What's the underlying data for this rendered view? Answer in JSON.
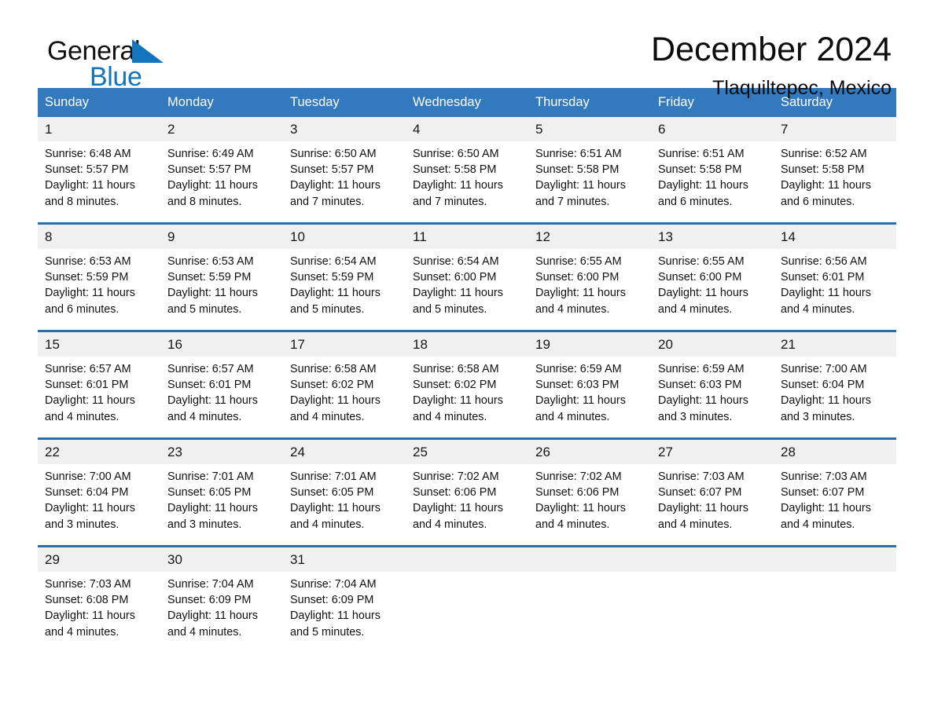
{
  "brand": {
    "word_one": "General",
    "word_two": "Blue",
    "triangle_icon": "brand-triangle-icon",
    "blue": "#1274bd"
  },
  "header": {
    "month_title": "December 2024",
    "location": "Tlaquiltepec, Mexico"
  },
  "theme": {
    "header_blue": "#3279bd",
    "row_rule_blue": "#2f6da9",
    "daynum_band": "#f0f0f0"
  },
  "calendar": {
    "weekday_headers": [
      "Sunday",
      "Monday",
      "Tuesday",
      "Wednesday",
      "Thursday",
      "Friday",
      "Saturday"
    ],
    "weeks": [
      [
        {
          "day": "1",
          "sunrise": "Sunrise: 6:48 AM",
          "sunset": "Sunset: 5:57 PM",
          "daylight": "Daylight: 11 hours and 8 minutes."
        },
        {
          "day": "2",
          "sunrise": "Sunrise: 6:49 AM",
          "sunset": "Sunset: 5:57 PM",
          "daylight": "Daylight: 11 hours and 8 minutes."
        },
        {
          "day": "3",
          "sunrise": "Sunrise: 6:50 AM",
          "sunset": "Sunset: 5:57 PM",
          "daylight": "Daylight: 11 hours and 7 minutes."
        },
        {
          "day": "4",
          "sunrise": "Sunrise: 6:50 AM",
          "sunset": "Sunset: 5:58 PM",
          "daylight": "Daylight: 11 hours and 7 minutes."
        },
        {
          "day": "5",
          "sunrise": "Sunrise: 6:51 AM",
          "sunset": "Sunset: 5:58 PM",
          "daylight": "Daylight: 11 hours and 7 minutes."
        },
        {
          "day": "6",
          "sunrise": "Sunrise: 6:51 AM",
          "sunset": "Sunset: 5:58 PM",
          "daylight": "Daylight: 11 hours and 6 minutes."
        },
        {
          "day": "7",
          "sunrise": "Sunrise: 6:52 AM",
          "sunset": "Sunset: 5:58 PM",
          "daylight": "Daylight: 11 hours and 6 minutes."
        }
      ],
      [
        {
          "day": "8",
          "sunrise": "Sunrise: 6:53 AM",
          "sunset": "Sunset: 5:59 PM",
          "daylight": "Daylight: 11 hours and 6 minutes."
        },
        {
          "day": "9",
          "sunrise": "Sunrise: 6:53 AM",
          "sunset": "Sunset: 5:59 PM",
          "daylight": "Daylight: 11 hours and 5 minutes."
        },
        {
          "day": "10",
          "sunrise": "Sunrise: 6:54 AM",
          "sunset": "Sunset: 5:59 PM",
          "daylight": "Daylight: 11 hours and 5 minutes."
        },
        {
          "day": "11",
          "sunrise": "Sunrise: 6:54 AM",
          "sunset": "Sunset: 6:00 PM",
          "daylight": "Daylight: 11 hours and 5 minutes."
        },
        {
          "day": "12",
          "sunrise": "Sunrise: 6:55 AM",
          "sunset": "Sunset: 6:00 PM",
          "daylight": "Daylight: 11 hours and 4 minutes."
        },
        {
          "day": "13",
          "sunrise": "Sunrise: 6:55 AM",
          "sunset": "Sunset: 6:00 PM",
          "daylight": "Daylight: 11 hours and 4 minutes."
        },
        {
          "day": "14",
          "sunrise": "Sunrise: 6:56 AM",
          "sunset": "Sunset: 6:01 PM",
          "daylight": "Daylight: 11 hours and 4 minutes."
        }
      ],
      [
        {
          "day": "15",
          "sunrise": "Sunrise: 6:57 AM",
          "sunset": "Sunset: 6:01 PM",
          "daylight": "Daylight: 11 hours and 4 minutes."
        },
        {
          "day": "16",
          "sunrise": "Sunrise: 6:57 AM",
          "sunset": "Sunset: 6:01 PM",
          "daylight": "Daylight: 11 hours and 4 minutes."
        },
        {
          "day": "17",
          "sunrise": "Sunrise: 6:58 AM",
          "sunset": "Sunset: 6:02 PM",
          "daylight": "Daylight: 11 hours and 4 minutes."
        },
        {
          "day": "18",
          "sunrise": "Sunrise: 6:58 AM",
          "sunset": "Sunset: 6:02 PM",
          "daylight": "Daylight: 11 hours and 4 minutes."
        },
        {
          "day": "19",
          "sunrise": "Sunrise: 6:59 AM",
          "sunset": "Sunset: 6:03 PM",
          "daylight": "Daylight: 11 hours and 4 minutes."
        },
        {
          "day": "20",
          "sunrise": "Sunrise: 6:59 AM",
          "sunset": "Sunset: 6:03 PM",
          "daylight": "Daylight: 11 hours and 3 minutes."
        },
        {
          "day": "21",
          "sunrise": "Sunrise: 7:00 AM",
          "sunset": "Sunset: 6:04 PM",
          "daylight": "Daylight: 11 hours and 3 minutes."
        }
      ],
      [
        {
          "day": "22",
          "sunrise": "Sunrise: 7:00 AM",
          "sunset": "Sunset: 6:04 PM",
          "daylight": "Daylight: 11 hours and 3 minutes."
        },
        {
          "day": "23",
          "sunrise": "Sunrise: 7:01 AM",
          "sunset": "Sunset: 6:05 PM",
          "daylight": "Daylight: 11 hours and 3 minutes."
        },
        {
          "day": "24",
          "sunrise": "Sunrise: 7:01 AM",
          "sunset": "Sunset: 6:05 PM",
          "daylight": "Daylight: 11 hours and 4 minutes."
        },
        {
          "day": "25",
          "sunrise": "Sunrise: 7:02 AM",
          "sunset": "Sunset: 6:06 PM",
          "daylight": "Daylight: 11 hours and 4 minutes."
        },
        {
          "day": "26",
          "sunrise": "Sunrise: 7:02 AM",
          "sunset": "Sunset: 6:06 PM",
          "daylight": "Daylight: 11 hours and 4 minutes."
        },
        {
          "day": "27",
          "sunrise": "Sunrise: 7:03 AM",
          "sunset": "Sunset: 6:07 PM",
          "daylight": "Daylight: 11 hours and 4 minutes."
        },
        {
          "day": "28",
          "sunrise": "Sunrise: 7:03 AM",
          "sunset": "Sunset: 6:07 PM",
          "daylight": "Daylight: 11 hours and 4 minutes."
        }
      ],
      [
        {
          "day": "29",
          "sunrise": "Sunrise: 7:03 AM",
          "sunset": "Sunset: 6:08 PM",
          "daylight": "Daylight: 11 hours and 4 minutes."
        },
        {
          "day": "30",
          "sunrise": "Sunrise: 7:04 AM",
          "sunset": "Sunset: 6:09 PM",
          "daylight": "Daylight: 11 hours and 4 minutes."
        },
        {
          "day": "31",
          "sunrise": "Sunrise: 7:04 AM",
          "sunset": "Sunset: 6:09 PM",
          "daylight": "Daylight: 11 hours and 5 minutes."
        },
        {
          "day": "",
          "sunrise": "",
          "sunset": "",
          "daylight": ""
        },
        {
          "day": "",
          "sunrise": "",
          "sunset": "",
          "daylight": ""
        },
        {
          "day": "",
          "sunrise": "",
          "sunset": "",
          "daylight": ""
        },
        {
          "day": "",
          "sunrise": "",
          "sunset": "",
          "daylight": ""
        }
      ]
    ]
  }
}
